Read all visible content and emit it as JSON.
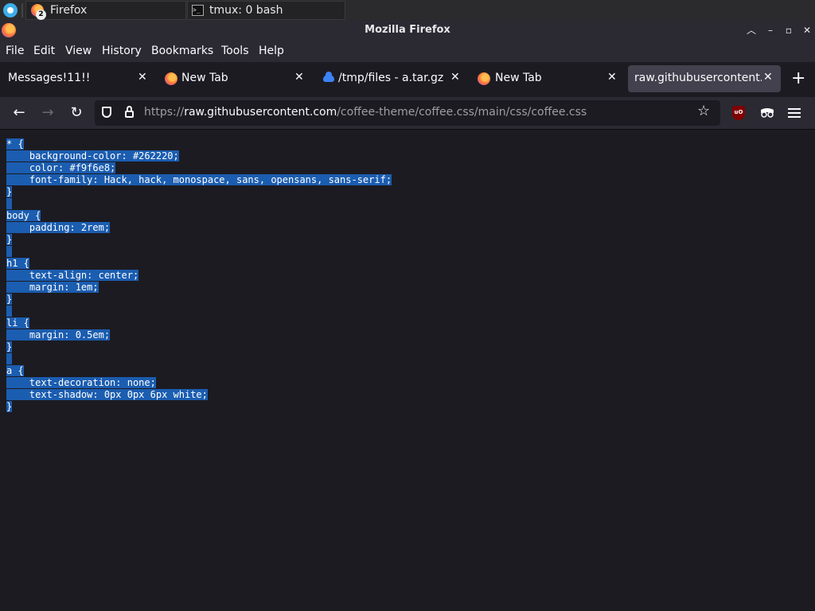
{
  "taskbar": {
    "tasks": [
      {
        "label": "Firefox",
        "badge": "2"
      },
      {
        "label": "tmux: 0 bash"
      }
    ]
  },
  "window": {
    "title": "Mozilla Firefox"
  },
  "menu": [
    "File",
    "Edit",
    "View",
    "History",
    "Bookmarks",
    "Tools",
    "Help"
  ],
  "tabs": [
    {
      "title": "Messages!11!!",
      "icon": "none",
      "active": false
    },
    {
      "title": "New Tab",
      "icon": "firefox-icon",
      "active": false
    },
    {
      "title": "/tmp/files - a.tar.gz",
      "icon": "cloud-icon",
      "active": false
    },
    {
      "title": "New Tab",
      "icon": "firefox-icon",
      "active": false
    },
    {
      "title": "raw.githubusercontent.c",
      "icon": "none",
      "active": true
    }
  ],
  "urlbar": {
    "scheme": "https://",
    "host": "raw.githubusercontent.com",
    "path": "/coffee-theme/coffee.css/main/css/coffee.css"
  },
  "code_lines": [
    "* {",
    "    background-color: #262220;",
    "    color: #f9f6e8;",
    "    font-family: Hack, hack, monospace, sans, opensans, sans-serif;",
    "}",
    "",
    "body {",
    "    padding: 2rem;",
    "}",
    "",
    "h1 {",
    "    text-align: center;",
    "    margin: 1em;",
    "}",
    "",
    "li {",
    "    margin: 0.5em;",
    "}",
    "",
    "a {",
    "    text-decoration: none;",
    "    text-shadow: 0px 0px 6px white;",
    "}"
  ],
  "colors": {
    "selection": "#1b5db0",
    "page_bg": "#1c1b22",
    "toolbar_bg": "#2b2a33"
  }
}
